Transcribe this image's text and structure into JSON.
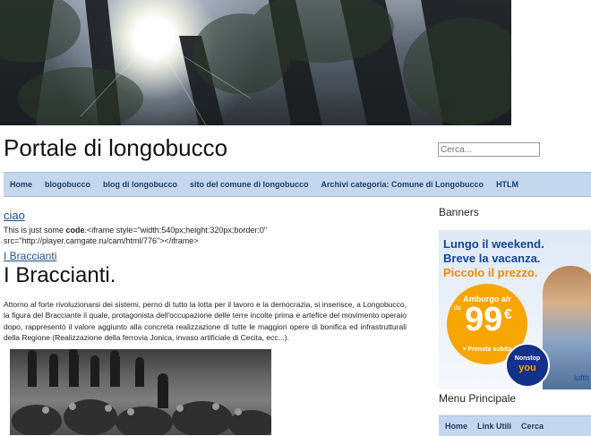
{
  "site": {
    "title": "Portale di longobucco",
    "search_placeholder": "Cerca..."
  },
  "nav": {
    "items": [
      "Home",
      "blogobucco",
      "blog di longobucco",
      "sito del comune di longobucco",
      "Archivi categoria: Comune di Longobucco",
      "HTLM"
    ]
  },
  "post": {
    "link": "ciao",
    "code_prefix": "This is just some ",
    "code_word": "code",
    "code_rest": ".<iframe style=\"width:540px;height:320px;border:0\" src=\"http://player.camgate.ru/cam/html/776\"></iframe>",
    "category_link": "I Braccianti",
    "title": "I Braccianti.",
    "body": "Attorno al forte rivoluzionarsi dei sistemi, perno di tutto la lotta per il lavoro e la democrazia, si inserisce, a Longobucco, la figura del Bracciante il quale, protagonista dell'occupazione delle terre incolte prima e artefice del movimento operaio dopo, rappresentò il valore aggiunto alla concreta realizzazione di tutte le maggiori opere di bonifica ed infrastrutturali della Regione (Realizzazione della ferrovia Jonica, invaso artificiale di Cecita, ecc...)."
  },
  "sidebar": {
    "banners_heading": "Banners",
    "ad": {
      "line1": "Lungo il weekend.",
      "line2": "Breve la vacanza.",
      "line3": "Piccolo il prezzo.",
      "route": "Amburgo a/r",
      "from": "da",
      "price": "99",
      "currency": "€",
      "cta": "> Prenota subito",
      "badge_line1": "Nonstop",
      "badge_line2": "you",
      "corner_text": "lufth"
    },
    "menu_heading": "Menu Principale",
    "menu_items": [
      "Home",
      "Link Utili",
      "Cerca"
    ]
  },
  "colors": {
    "nav_bg": "#c4d7ee",
    "link": "#1d4f8c",
    "ad_blue": "#13459a",
    "ad_orange": "#f7a500"
  }
}
